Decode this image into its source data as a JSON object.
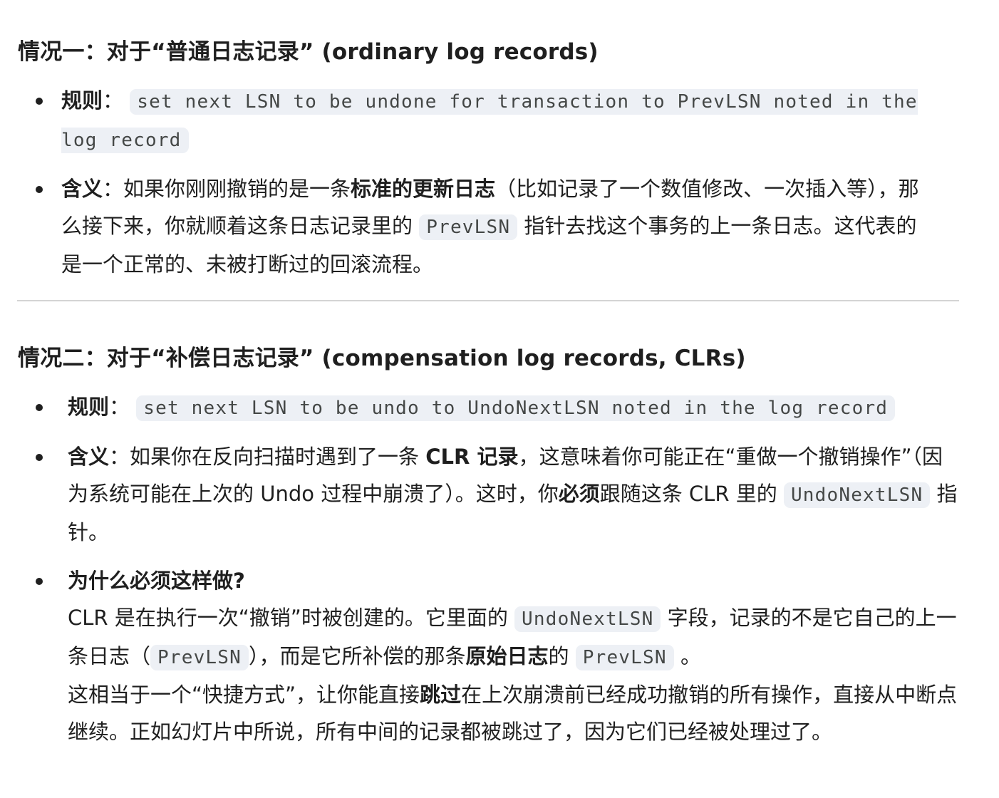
{
  "section1": {
    "title": "情况一：对于“普通日志记录” (ordinary log records)",
    "rule_label": "规则",
    "rule_sep": "：",
    "rule_code": "set next LSN to be undone for transaction to PrevLSN noted in the log record",
    "meaning_label": "含义",
    "meaning_sep": "：",
    "meaning_text1": "如果你刚刚撤销的是一条",
    "meaning_bold1": "标准的更新日志",
    "meaning_text2": "（比如记录了一个数值修改、一次插入等），那么接下来，你就顺着这条日志记录里的 ",
    "meaning_code1": "PrevLSN",
    "meaning_text3": " 指针去找这个事务的上一条日志。这代表的是一个正常的、未被打断过的回滚流程。"
  },
  "section2": {
    "title": "情况二：对于“补偿日志记录” (compensation log records, CLRs)",
    "rule_label": "规则",
    "rule_sep": "：",
    "rule_code": "set next LSN to be undo to UndoNextLSN noted in the log record",
    "meaning_label": "含义",
    "meaning_sep": "：",
    "meaning_text1": "如果你在反向扫描时遇到了一条 ",
    "meaning_bold1": "CLR 记录",
    "meaning_text2": "，这意味着你可能正在“重做一个撤销操作”（因为系统可能在上次的 Undo 过程中崩溃了）。这时，你",
    "meaning_bold2": "必须",
    "meaning_text3": "跟随这条 CLR 里的 ",
    "meaning_code1": "UndoNextLSN",
    "meaning_text4": " 指针。",
    "why_label": "为什么必须这样做?",
    "why_text1": "CLR 是在执行一次“撤销”时被创建的。它里面的 ",
    "why_code1": "UndoNextLSN",
    "why_text2": " 字段，记录的不是它自己的上一条日志（",
    "why_code2": "PrevLSN",
    "why_text3": "），而是它所补偿的那条",
    "why_bold1": "原始日志",
    "why_text4": "的 ",
    "why_code3": "PrevLSN",
    "why_text5": " 。",
    "why2_text1": "这相当于一个“快捷方式”，让你能直接",
    "why2_bold1": "跳过",
    "why2_text2": "在上次崩溃前已经成功撤销的所有操作，直接从中断点继续。正如幻灯片中所说，所有中间的记录都被跳过了，因为它们已经被处理过了。"
  }
}
